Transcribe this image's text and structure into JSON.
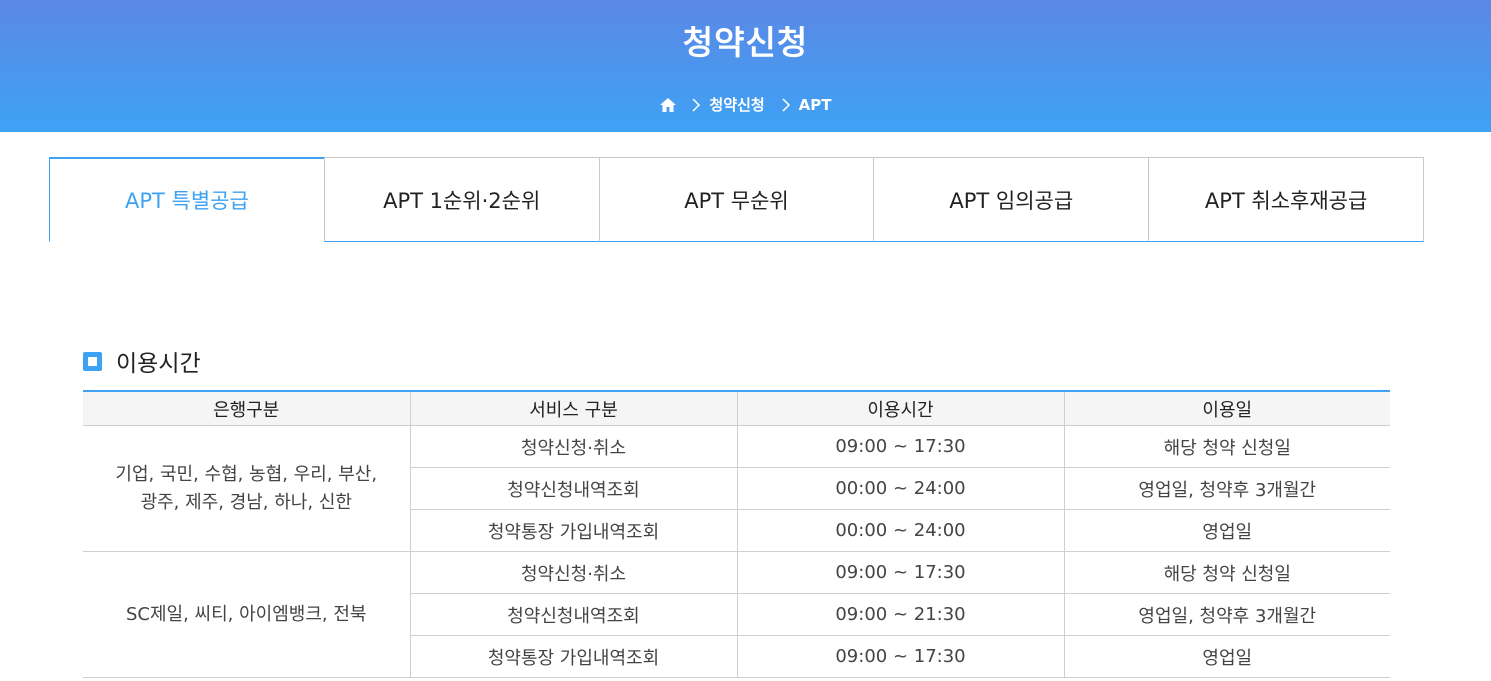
{
  "banner": {
    "title": "청약신청",
    "breadcrumb": [
      "청약신청",
      "APT"
    ]
  },
  "tabs": [
    {
      "label": "APT 특별공급",
      "active": true
    },
    {
      "label": "APT 1순위·2순위",
      "active": false
    },
    {
      "label": "APT 무순위",
      "active": false
    },
    {
      "label": "APT 임의공급",
      "active": false
    },
    {
      "label": "APT 취소후재공급",
      "active": false
    }
  ],
  "section": {
    "title": "이용시간"
  },
  "table": {
    "headers": [
      "은행구분",
      "서비스 구분",
      "이용시간",
      "이용일"
    ],
    "groups": [
      {
        "bank": "기업, 국민, 수협, 농협, 우리, 부산,\n광주, 제주, 경남, 하나, 신한",
        "rows": [
          {
            "service": "청약신청·취소",
            "time": "09:00 ~ 17:30",
            "days": "해당 청약 신청일"
          },
          {
            "service": "청약신청내역조회",
            "time": "00:00 ~ 24:00",
            "days": "영업일, 청약후 3개월간"
          },
          {
            "service": "청약통장 가입내역조회",
            "time": "00:00 ~ 24:00",
            "days": "영업일"
          }
        ]
      },
      {
        "bank": "SC제일, 씨티, 아이엠뱅크, 전북",
        "rows": [
          {
            "service": "청약신청·취소",
            "time": "09:00 ~ 17:30",
            "days": "해당 청약 신청일"
          },
          {
            "service": "청약신청내역조회",
            "time": "09:00 ~ 21:30",
            "days": "영업일, 청약후 3개월간"
          },
          {
            "service": "청약통장 가입내역조회",
            "time": "09:00 ~ 17:30",
            "days": "영업일"
          }
        ]
      }
    ]
  },
  "colors": {
    "accent": "#3ea2f4",
    "banner_top": "#5b88e6"
  },
  "icons": {
    "home": "home-icon",
    "separator": "chevron-right-icon",
    "section_marker": "square-icon"
  }
}
